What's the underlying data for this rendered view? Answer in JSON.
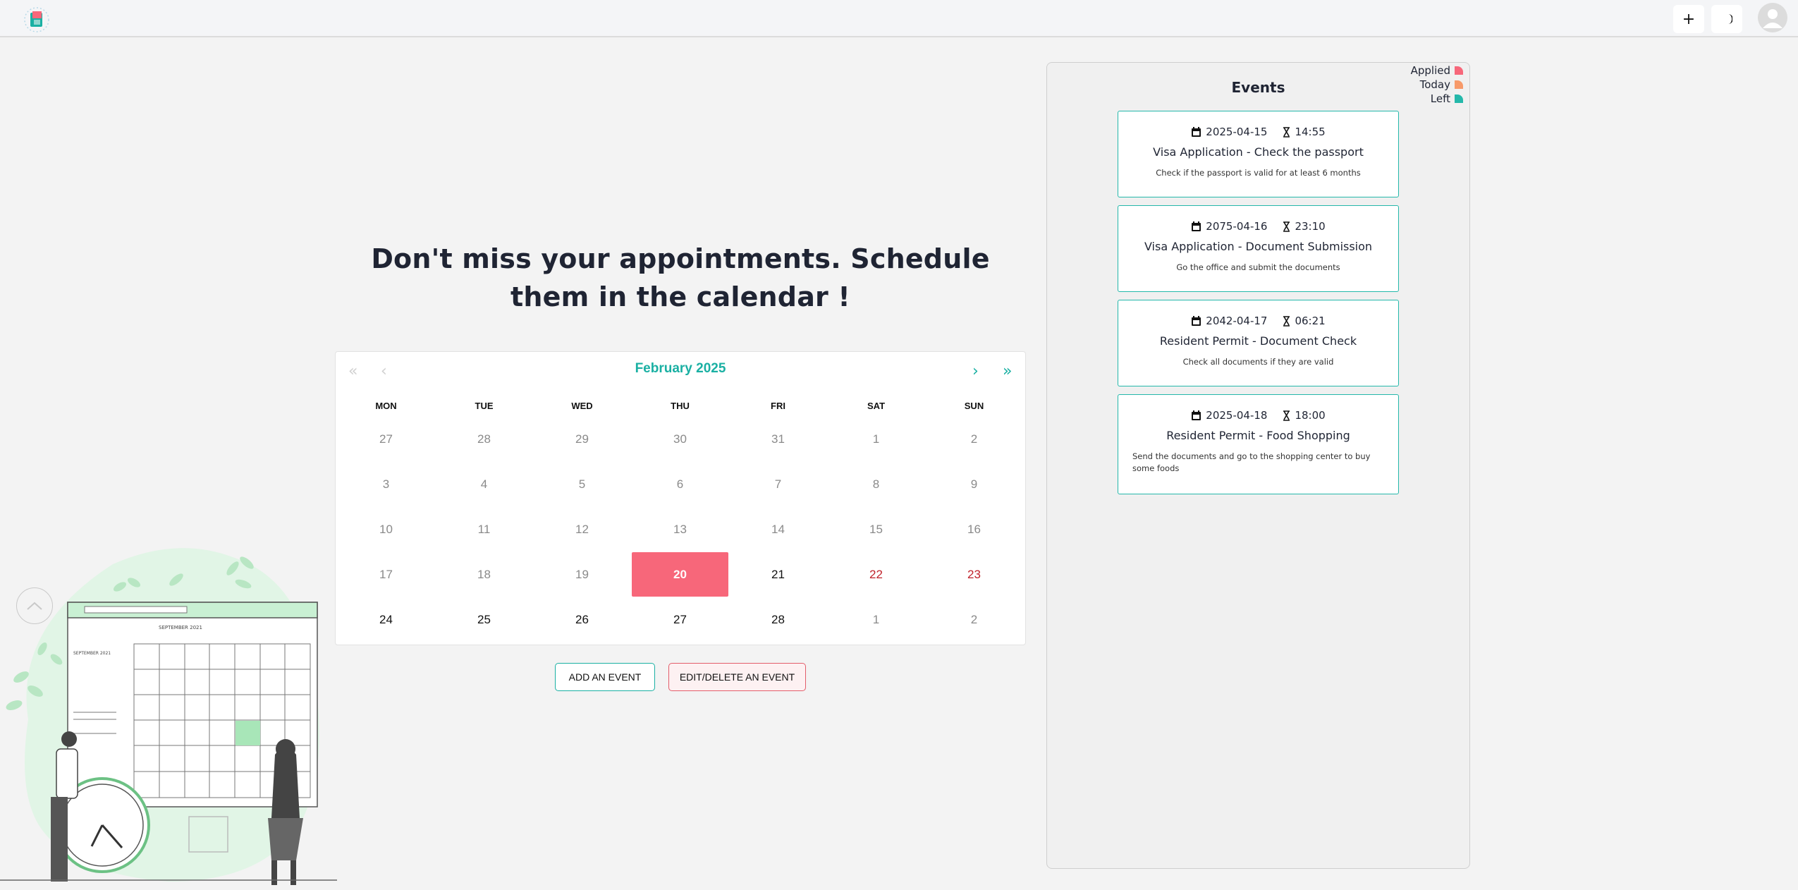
{
  "topbar": {
    "add_label": "+",
    "theme_icon": "moon-icon",
    "avatar_icon": "user-avatar-icon"
  },
  "headline": "Don't miss your appointments. Schedule them in the calendar !",
  "calendar": {
    "title": "February 2025",
    "nav": {
      "prev_year": "«",
      "prev_month": "‹",
      "next_month": "›",
      "next_year": "»"
    },
    "weekdays": [
      "MON",
      "TUE",
      "WED",
      "THU",
      "FRI",
      "SAT",
      "SUN"
    ],
    "weeks": [
      [
        {
          "d": "27",
          "s": "muted"
        },
        {
          "d": "28",
          "s": "muted"
        },
        {
          "d": "29",
          "s": "muted"
        },
        {
          "d": "30",
          "s": "muted"
        },
        {
          "d": "31",
          "s": "muted"
        },
        {
          "d": "1",
          "s": "muted"
        },
        {
          "d": "2",
          "s": "muted"
        }
      ],
      [
        {
          "d": "3",
          "s": "muted"
        },
        {
          "d": "4",
          "s": "muted"
        },
        {
          "d": "5",
          "s": "muted"
        },
        {
          "d": "6",
          "s": "muted"
        },
        {
          "d": "7",
          "s": "muted"
        },
        {
          "d": "8",
          "s": "muted"
        },
        {
          "d": "9",
          "s": "muted"
        }
      ],
      [
        {
          "d": "10",
          "s": "muted"
        },
        {
          "d": "11",
          "s": "muted"
        },
        {
          "d": "12",
          "s": "muted"
        },
        {
          "d": "13",
          "s": "muted"
        },
        {
          "d": "14",
          "s": "muted"
        },
        {
          "d": "15",
          "s": "muted"
        },
        {
          "d": "16",
          "s": "muted"
        }
      ],
      [
        {
          "d": "17",
          "s": "muted"
        },
        {
          "d": "18",
          "s": "muted"
        },
        {
          "d": "19",
          "s": "muted"
        },
        {
          "d": "20",
          "s": "today"
        },
        {
          "d": "21",
          "s": "cur"
        },
        {
          "d": "22",
          "s": "weekend"
        },
        {
          "d": "23",
          "s": "weekend"
        }
      ],
      [
        {
          "d": "24",
          "s": "cur"
        },
        {
          "d": "25",
          "s": "cur"
        },
        {
          "d": "26",
          "s": "cur"
        },
        {
          "d": "27",
          "s": "cur"
        },
        {
          "d": "28",
          "s": "cur"
        },
        {
          "d": "1",
          "s": "muted"
        },
        {
          "d": "2",
          "s": "muted"
        }
      ]
    ]
  },
  "actions": {
    "add": "ADD AN EVENT",
    "edit": "EDIT/DELETE AN EVENT"
  },
  "events_panel": {
    "title": "Events",
    "legend": [
      {
        "label": "Applied",
        "color": "#f7677a"
      },
      {
        "label": "Today",
        "color": "#f79a6a"
      },
      {
        "label": "Left",
        "color": "#24b8aa"
      }
    ],
    "events": [
      {
        "date": "2025-04-15",
        "time": "14:55",
        "title": "Visa Application - Check the passport",
        "desc": "Check if the passport is valid for at least 6 months"
      },
      {
        "date": "2075-04-16",
        "time": "23:10",
        "title": "Visa Application - Document Submission",
        "desc": "Go the office and submit the documents"
      },
      {
        "date": "2042-04-17",
        "time": "06:21",
        "title": "Resident Permit - Document Check",
        "desc": "Check all documents if they are valid"
      },
      {
        "date": "2025-04-18",
        "time": "18:00",
        "title": "Resident Permit - Food Shopping",
        "desc": "Send the documents and go to the shopping center to buy some foods"
      }
    ]
  },
  "illustration": {
    "month_label": "SEPTEMBER 2021",
    "mini_month_label": "SEPTEMBER 2021"
  }
}
